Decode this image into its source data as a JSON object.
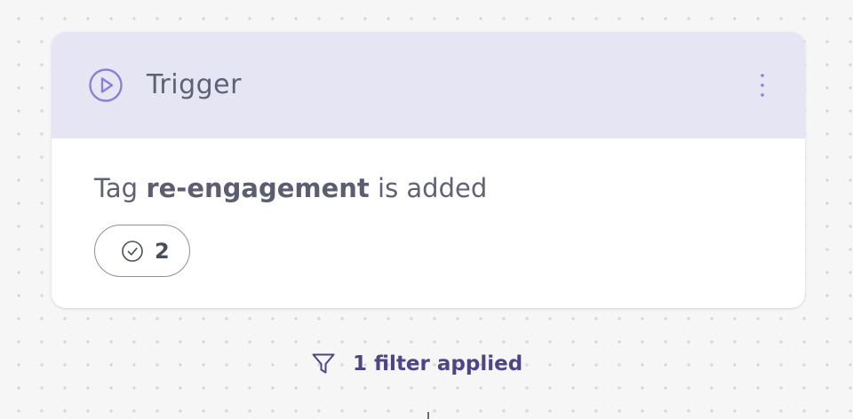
{
  "trigger": {
    "title": "Trigger",
    "condition_prefix": "Tag",
    "tag_name": "re-engagement",
    "condition_suffix": "is added",
    "completed_count": "2"
  },
  "filter": {
    "label": "1 filter applied"
  },
  "icons": {
    "trigger": "play-circle-icon",
    "menu": "more-vertical-icon",
    "count": "check-circle-icon",
    "filter": "funnel-icon"
  },
  "colors": {
    "header_background": "#e6e5f4",
    "accent_purple": "#8b7fd6",
    "filter_text": "#4f4485",
    "canvas_background": "#f6f6f7"
  }
}
